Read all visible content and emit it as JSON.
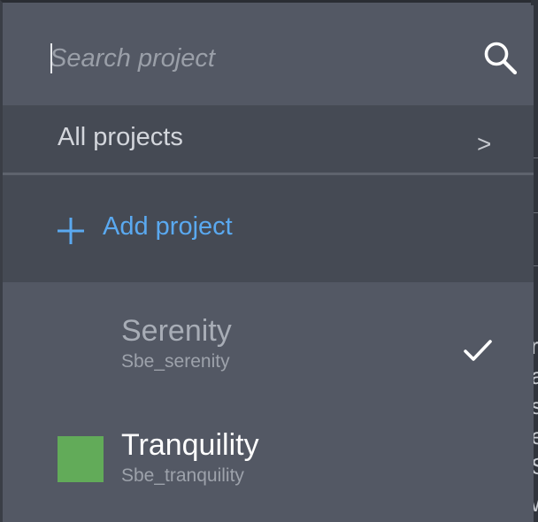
{
  "search": {
    "placeholder": "Search project",
    "value": "",
    "icon": "search-icon"
  },
  "all_projects": {
    "label": "All projects",
    "chevron": ">"
  },
  "add_project": {
    "icon": "plus-icon",
    "label": "Add project",
    "color": "#5aa9f0"
  },
  "projects": [
    {
      "name": "Serenity",
      "key": "Sbe_serenity",
      "selected": true,
      "color": null
    },
    {
      "name": "Tranquility",
      "key": "Sbe_tranquility",
      "selected": false,
      "color": "#62ab59"
    }
  ],
  "background_glyphs": [
    "r",
    "a",
    "s",
    "e",
    "S",
    "w"
  ],
  "colors": {
    "panel": "#535864",
    "section": "#454a54",
    "accent": "#5aa9f0"
  }
}
